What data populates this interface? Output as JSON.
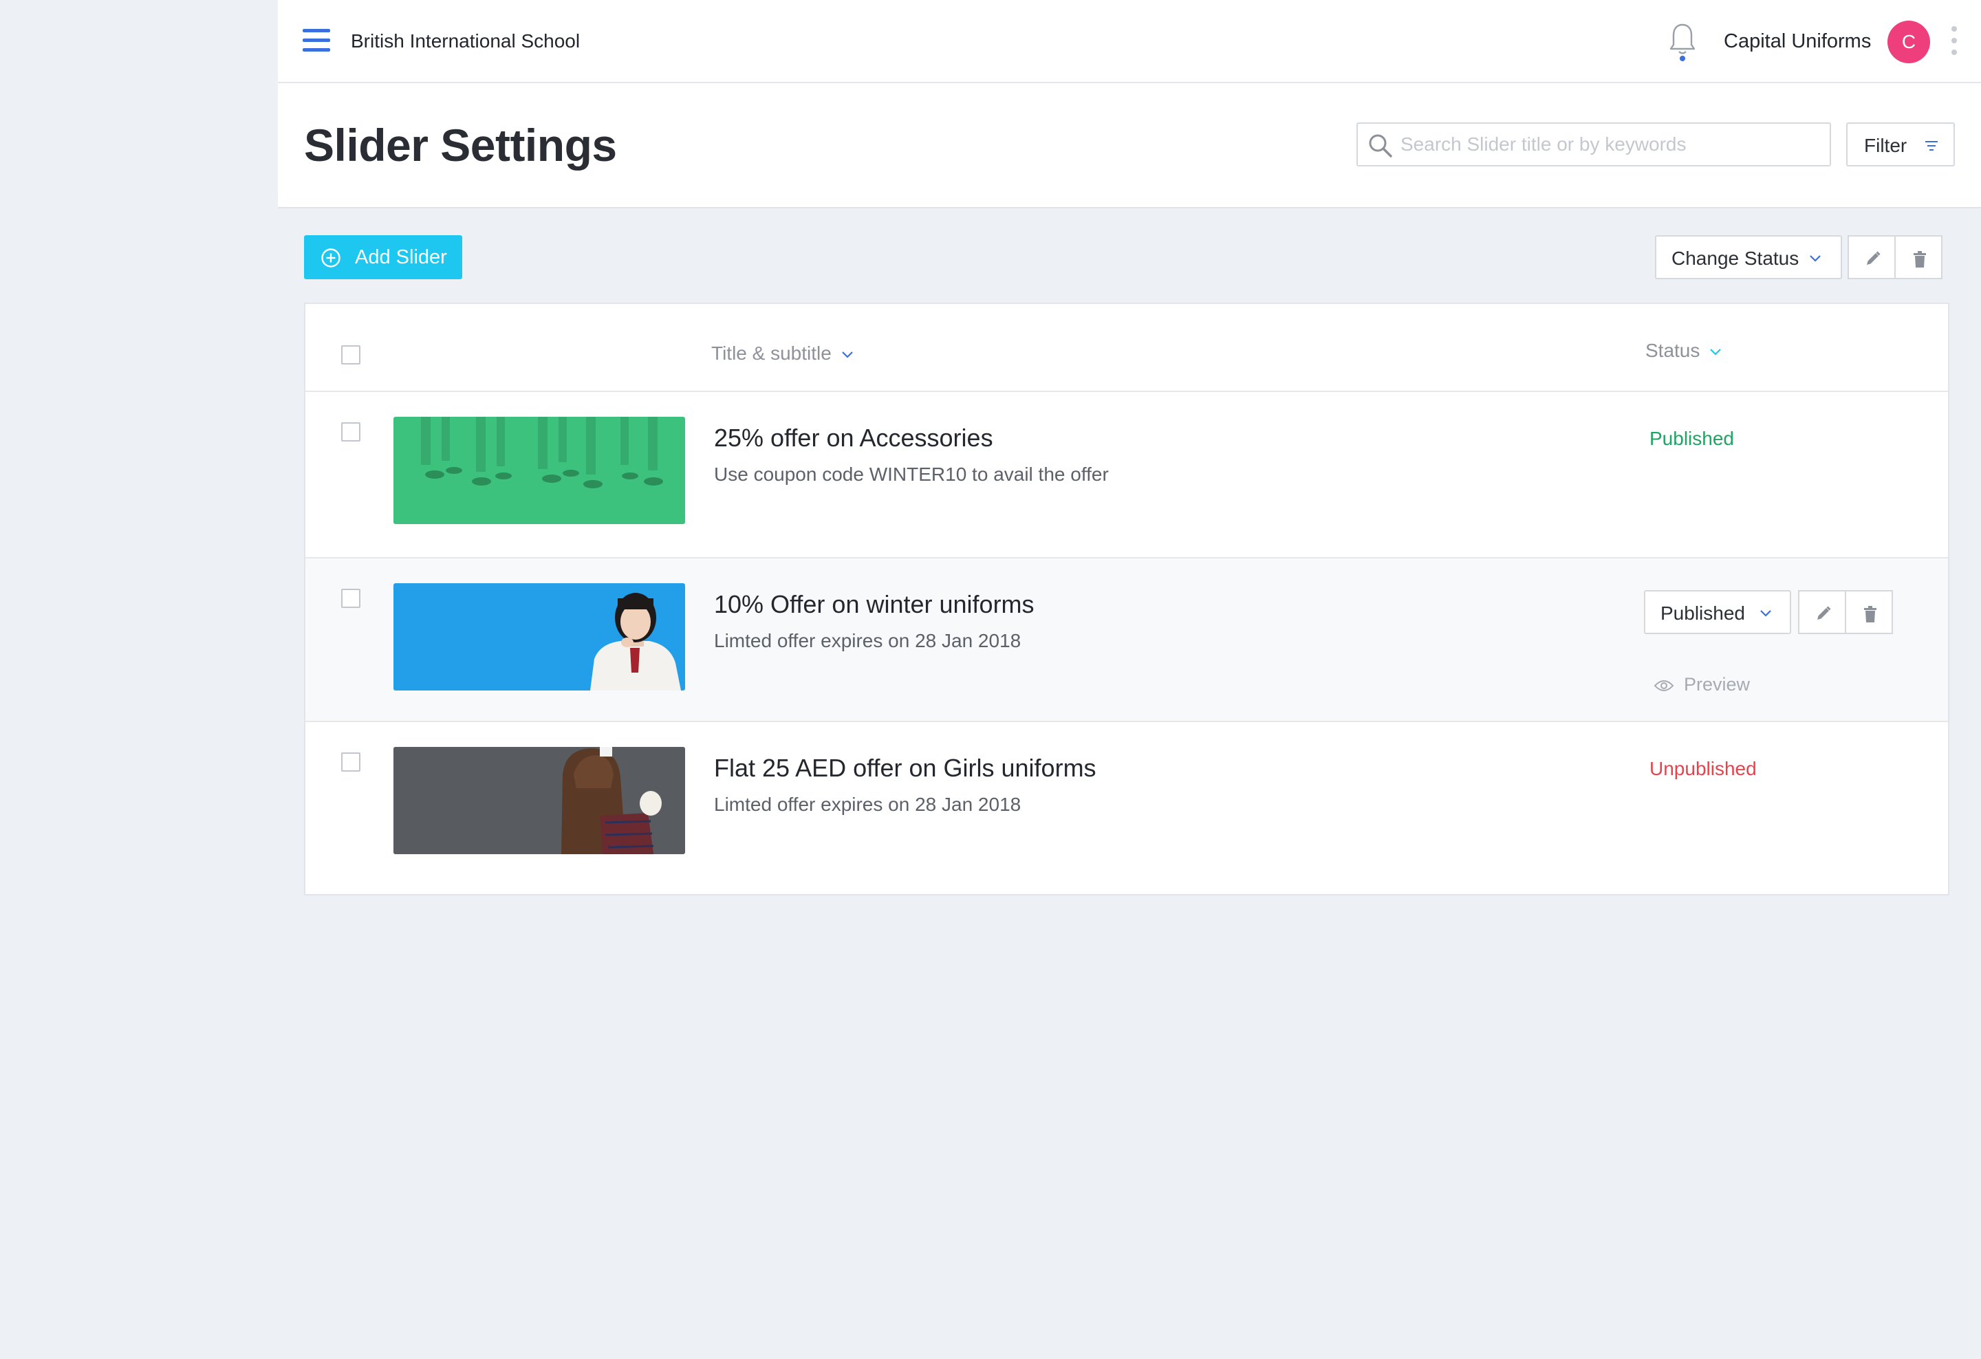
{
  "header": {
    "school_name": "British International School",
    "company_name": "Capital Uniforms",
    "avatar_initial": "C"
  },
  "page": {
    "title": "Slider Settings",
    "search_placeholder": "Search Slider title or by keywords",
    "filter_label": "Filter"
  },
  "toolbar": {
    "add_label": "Add Slider",
    "change_status_label": "Change Status"
  },
  "table": {
    "columns": {
      "title": "Title & subtitle",
      "status": "Status"
    },
    "rows": [
      {
        "title": "25% offer on Accessories",
        "subtitle": "Use coupon code WINTER10 to avail the offer",
        "status": "Published"
      },
      {
        "title": "10% Offer on winter uniforms",
        "subtitle": "Limted offer expires on 28 Jan 2018",
        "status": "Published",
        "preview_label": "Preview"
      },
      {
        "title": "Flat 25 AED offer on Girls uniforms",
        "subtitle": "Limted offer expires on 28 Jan 2018",
        "status": "Unpublished"
      }
    ]
  },
  "colors": {
    "accent": "#1dc7ef",
    "brand_blue": "#3a6fe0",
    "published": "#1fa463",
    "unpublished": "#e8434b",
    "avatar": "#ef3e7c"
  },
  "icons": {
    "menu": "hamburger-icon",
    "notifications": "bell-icon",
    "more": "kebab-icon",
    "search": "search-icon",
    "filter": "filter-icon",
    "add": "plus-circle-icon",
    "edit": "pencil-icon",
    "delete": "trash-icon",
    "preview": "eye-icon"
  }
}
